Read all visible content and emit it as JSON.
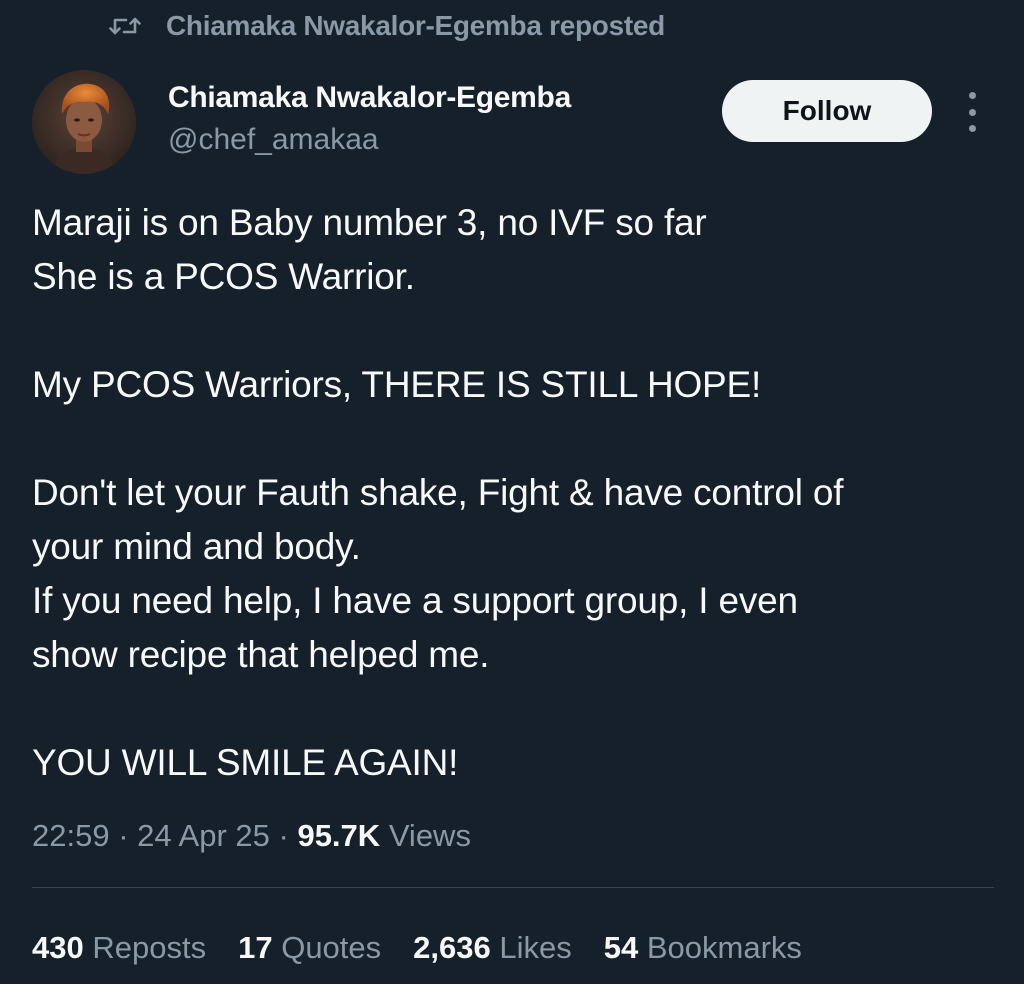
{
  "repost": {
    "text": "Chiamaka Nwakalor-Egemba reposted",
    "icon": "repost-icon"
  },
  "author": {
    "name": "Chiamaka Nwakalor-Egemba",
    "handle": "@chef_amakaa",
    "avatar_icon": "avatar"
  },
  "actions": {
    "follow_label": "Follow",
    "more_icon": "more-icon"
  },
  "tweet": {
    "lines": [
      "Maraji is on Baby number 3, no IVF so far",
      "She is a PCOS Warrior.",
      "",
      "My PCOS Warriors, THERE IS STILL HOPE!",
      "",
      "Don't let your Fauth shake, Fight & have control of",
      "your mind and body.",
      "If you need help, I have a support group, I even",
      "show recipe that helped me.",
      "",
      "YOU WILL SMILE AGAIN!"
    ]
  },
  "meta": {
    "time": "22:59",
    "date": "24 Apr 25",
    "separator": "·",
    "views_count": "95.7K",
    "views_label": "Views"
  },
  "stats": {
    "reposts_count": "430",
    "reposts_label": "Reposts",
    "quotes_count": "17",
    "quotes_label": "Quotes",
    "likes_count": "2,636",
    "likes_label": "Likes",
    "bookmarks_count": "54",
    "bookmarks_label": "Bookmarks"
  },
  "colors": {
    "background": "#15202b",
    "primary_text": "#f7f9f9",
    "secondary_text": "#8b98a5",
    "follow_button": "#eff3f4"
  }
}
